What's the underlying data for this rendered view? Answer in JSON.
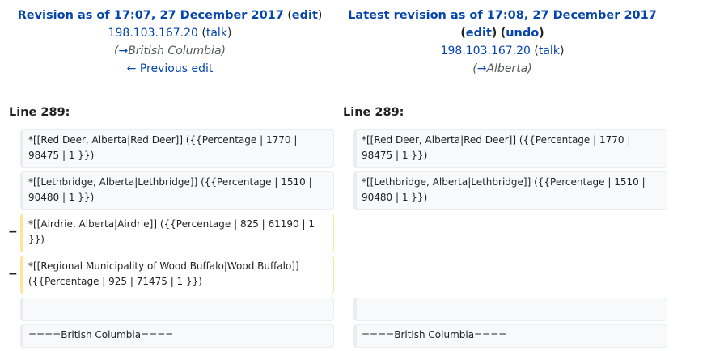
{
  "left_header": {
    "title": "Revision as of 17:07, 27 December 2017",
    "edit_label": "edit",
    "user": "198.103.167.20",
    "talk_label": "talk",
    "summary_arrow": "→",
    "summary_text": "British Columbia",
    "prev_edit_label": "← Previous edit"
  },
  "right_header": {
    "title": "Latest revision as of 17:08, 27 December 2017",
    "edit_label": "edit",
    "undo_label": "undo",
    "user": "198.103.167.20",
    "talk_label": "talk",
    "summary_arrow": "→",
    "summary_text": "Alberta"
  },
  "diff": {
    "left_line": "Line 289:",
    "right_line": "Line 289:",
    "removed_marker": "−",
    "left_rows": [
      {
        "line1": "*[[Red Deer, Alberta|Red Deer]] ({{Percentage | 1770 |",
        "line2": "98475 | 1 }})"
      },
      {
        "line1": "*[[Lethbridge, Alberta|Lethbridge]] ({{Percentage | 1510 |",
        "line2": "90480 | 1 }})"
      },
      {
        "line1": "*[[Airdrie, Alberta|Airdrie]] ({{Percentage | 825 | 61190 | 1",
        "line2": "}})"
      },
      {
        "line1": "*[[Regional Municipality of Wood Buffalo|Wood Buffalo]]",
        "line2": "({{Percentage | 925 | 71475 | 1 }})"
      },
      {
        "line1": "",
        "line2": ""
      },
      {
        "line1": "====British Columbia====",
        "line2": ""
      }
    ],
    "right_rows": [
      {
        "line1": "*[[Red Deer, Alberta|Red Deer]] ({{Percentage | 1770 |",
        "line2": "98475 | 1 }})"
      },
      {
        "line1": "*[[Lethbridge, Alberta|Lethbridge]] ({{Percentage | 1510 |",
        "line2": "90480 | 1 }})"
      },
      {
        "line1": "",
        "line2": ""
      },
      {
        "line1": "====British Columbia====",
        "line2": ""
      }
    ]
  }
}
